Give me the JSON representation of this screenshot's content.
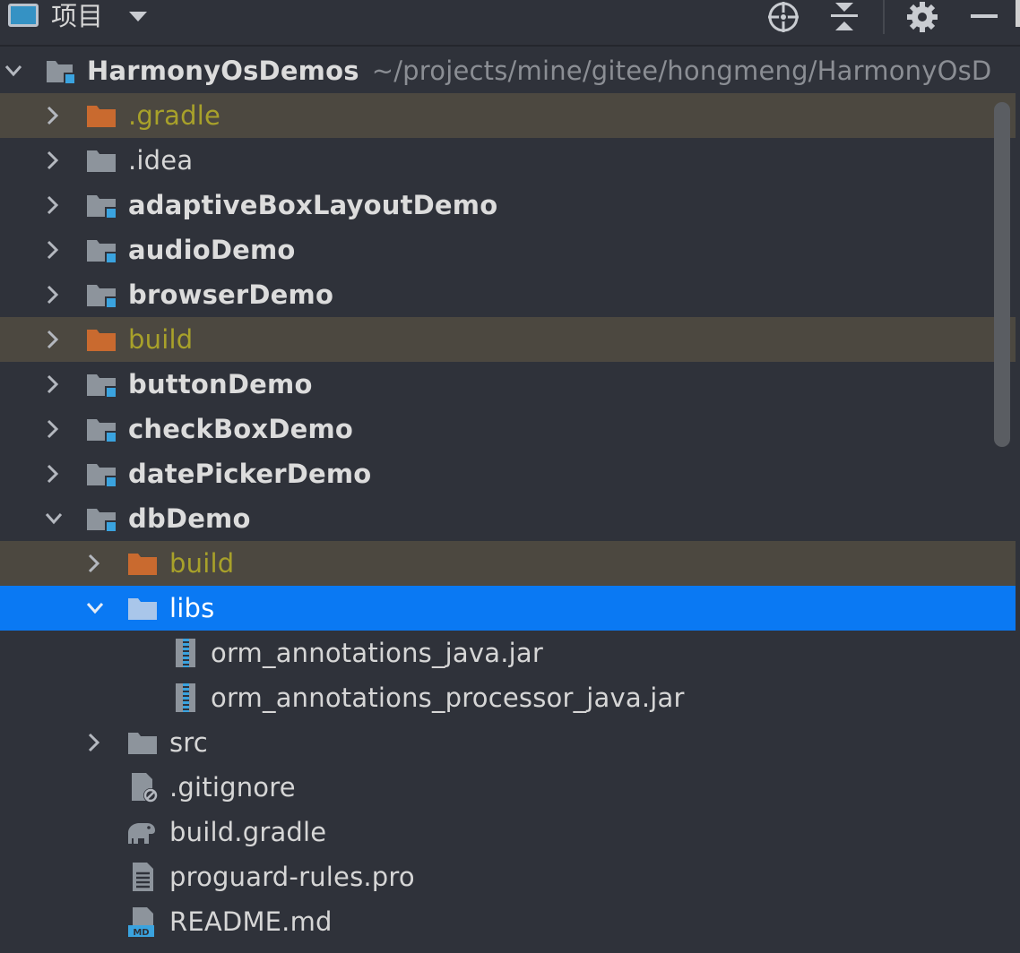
{
  "toolbar": {
    "title": "项目",
    "icons": [
      "project-view-icon",
      "dropdown-arrow-icon",
      "locate-target-icon",
      "collapse-all-icon",
      "settings-gear-icon",
      "minimize-icon"
    ]
  },
  "colors": {
    "background": "#2f323a",
    "selected_row": "#0a79f3",
    "excluded_row": "#4c4840",
    "excluded_text": "#a8a12a",
    "excluded_folder": "#c96a2f",
    "module_square": "#3aa3df",
    "folder_gray": "#8d949c",
    "path_text": "#8b8e94"
  },
  "tree": {
    "root": {
      "name": "HarmonyOsDemos",
      "path": "~/projects/mine/gitee/hongmeng/HarmonyOsD"
    },
    "items": [
      {
        "label": ".gradle"
      },
      {
        "label": ".idea"
      },
      {
        "label": "adaptiveBoxLayoutDemo"
      },
      {
        "label": "audioDemo"
      },
      {
        "label": "browserDemo"
      },
      {
        "label": "build"
      },
      {
        "label": "buttonDemo"
      },
      {
        "label": "checkBoxDemo"
      },
      {
        "label": "datePickerDemo"
      },
      {
        "label": "dbDemo"
      },
      {
        "label": "build"
      },
      {
        "label": "libs"
      },
      {
        "label": "orm_annotations_java.jar"
      },
      {
        "label": "orm_annotations_processor_java.jar"
      },
      {
        "label": "src"
      },
      {
        "label": ".gitignore"
      },
      {
        "label": "build.gradle"
      },
      {
        "label": "proguard-rules.pro"
      },
      {
        "label": "README.md"
      }
    ]
  }
}
